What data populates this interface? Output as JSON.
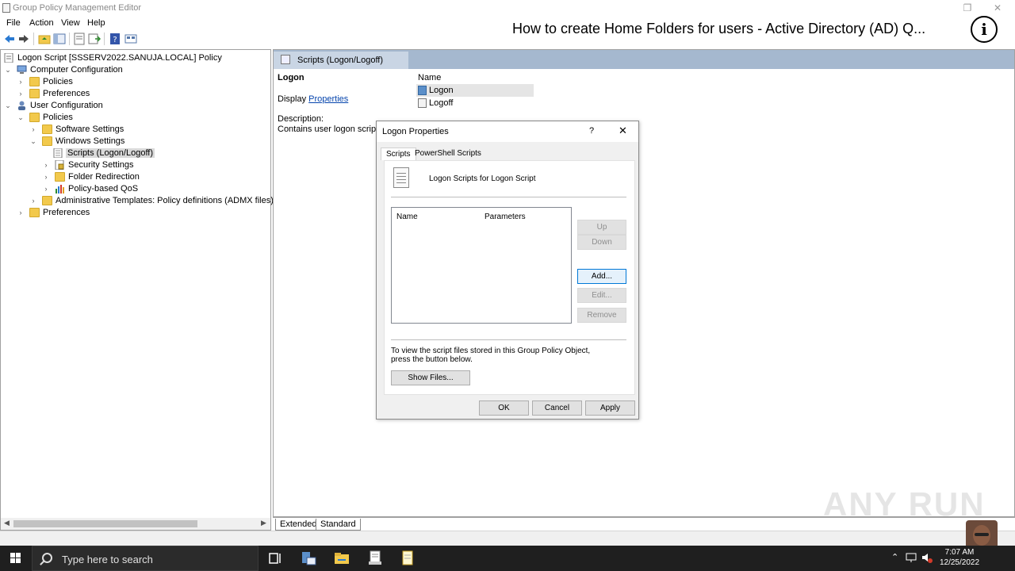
{
  "window": {
    "title": "Group Policy Management Editor",
    "controls": [
      "minimize",
      "restore",
      "close"
    ]
  },
  "video_overlay": {
    "title": "How to create Home Folders for users - Active Directory (AD) Q...",
    "info_glyph": "i"
  },
  "menu": {
    "items": [
      "File",
      "Action",
      "View",
      "Help"
    ]
  },
  "toolbar": {
    "icons": [
      "back-arrow-icon",
      "forward-arrow-icon",
      "up-folder-icon",
      "show-hide-tree-icon",
      "export-list-icon",
      "properties-icon",
      "help-icon",
      "view-icon"
    ]
  },
  "tree": {
    "items": [
      {
        "label": "Logon Script [SSSERV2022.SANUJA.LOCAL] Policy",
        "level": 0,
        "chev": "",
        "icon": "policy"
      },
      {
        "label": "Computer Configuration",
        "level": 0,
        "chev": "v",
        "icon": "computer"
      },
      {
        "label": "Policies",
        "level": 1,
        "chev": ">",
        "icon": "folder"
      },
      {
        "label": "Preferences",
        "level": 1,
        "chev": ">",
        "icon": "folder"
      },
      {
        "label": "User Configuration",
        "level": 0,
        "chev": "v",
        "icon": "user"
      },
      {
        "label": "Policies",
        "level": 1,
        "chev": "v",
        "icon": "folder"
      },
      {
        "label": "Software Settings",
        "level": 2,
        "chev": ">",
        "icon": "folder"
      },
      {
        "label": "Windows Settings",
        "level": 2,
        "chev": "v",
        "icon": "folder"
      },
      {
        "label": "Scripts (Logon/Logoff)",
        "level": 3,
        "chev": "",
        "icon": "script",
        "selected": true
      },
      {
        "label": "Security Settings",
        "level": 3,
        "chev": ">",
        "icon": "security"
      },
      {
        "label": "Folder Redirection",
        "level": 3,
        "chev": ">",
        "icon": "folder"
      },
      {
        "label": "Policy-based QoS",
        "level": 3,
        "chev": ">",
        "icon": "chart"
      },
      {
        "label": "Administrative Templates: Policy definitions (ADMX files) retrieve",
        "level": 2,
        "chev": ">",
        "icon": "folder"
      },
      {
        "label": "Preferences",
        "level": 1,
        "chev": ">",
        "icon": "folder"
      }
    ]
  },
  "right_pane": {
    "header": "Scripts (Logon/Logoff)",
    "heading": "Logon",
    "display_prefix": "Display",
    "display_link": "Properties",
    "description_label": "Description:",
    "description_text": "Contains user logon scripts.",
    "name_column": "Name",
    "list": [
      {
        "label": "Logon",
        "selected": true
      },
      {
        "label": "Logoff",
        "selected": false
      }
    ]
  },
  "bottom_tabs": [
    "Extended",
    "Standard"
  ],
  "dialog": {
    "title": "Logon Properties",
    "help": "?",
    "close": "✕",
    "tabs": [
      "Scripts",
      "PowerShell Scripts"
    ],
    "active_tab": "Scripts",
    "heading": "Logon Scripts for Logon Script",
    "columns": [
      "Name",
      "Parameters"
    ],
    "side_buttons": {
      "up": "Up",
      "down": "Down",
      "add": "Add...",
      "edit": "Edit...",
      "remove": "Remove"
    },
    "info_text": "To view the script files stored in this Group Policy Object, press the button below.",
    "show_files": "Show Files...",
    "ok": "OK",
    "cancel": "Cancel",
    "apply": "Apply"
  },
  "watermark": "ANY RUN",
  "taskbar": {
    "search_placeholder": "Type here to search",
    "time": "7:07 AM",
    "date": "12/25/2022"
  }
}
